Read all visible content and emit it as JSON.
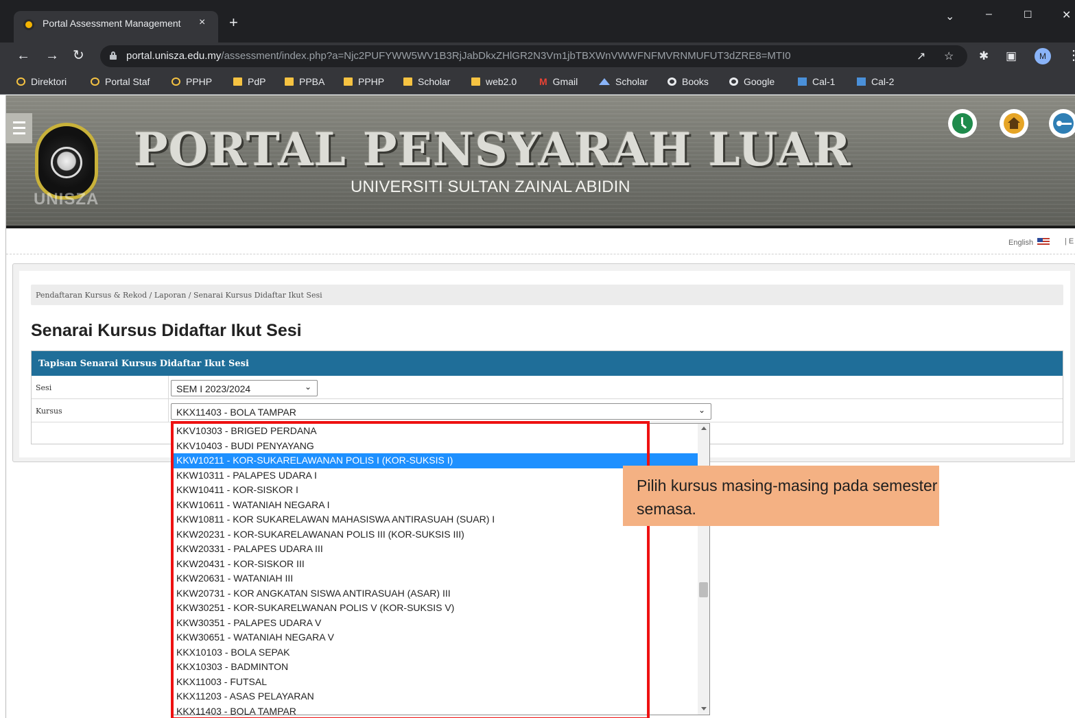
{
  "browser": {
    "tab_title": "Portal Assessment Management",
    "tab_close": "×",
    "new_tab": "+",
    "url_host": "portal.unisza.edu.my",
    "url_path": "/assessment/index.php?a=Njc2PUFYWW5WV1B3RjJabDkxZHlGR2N3Vm1jbTBXWnVWWFNFMVRNMUFUT3dZRE8=MTI0",
    "profile_initial": "M",
    "colors": {
      "frame": "#1f2023",
      "toolbar": "#35363a",
      "omnibox": "#202124"
    }
  },
  "bookmarks": [
    {
      "label": "Direktori",
      "icon": "globe-icon"
    },
    {
      "label": "Portal Staf",
      "icon": "globe-icon"
    },
    {
      "label": "PPHP",
      "icon": "globe-icon"
    },
    {
      "label": "PdP",
      "icon": "folder-icon"
    },
    {
      "label": "PPBA",
      "icon": "folder-icon"
    },
    {
      "label": "PPHP",
      "icon": "folder-icon"
    },
    {
      "label": "Scholar",
      "icon": "folder-icon"
    },
    {
      "label": "web2.0",
      "icon": "folder-icon"
    },
    {
      "label": "Gmail",
      "icon": "gmail-icon"
    },
    {
      "label": "Scholar",
      "icon": "scholar-cap-icon"
    },
    {
      "label": "Books",
      "icon": "google-icon"
    },
    {
      "label": "Google",
      "icon": "google-icon"
    },
    {
      "label": "Cal-1",
      "icon": "calendar-icon"
    },
    {
      "label": "Cal-2",
      "icon": "calendar-icon"
    }
  ],
  "header": {
    "logo_text": "UNISZA",
    "title": "PORTAL PENSYARAH LUAR",
    "subtitle": "UNIVERSITI SULTAN ZAINAL ABIDIN",
    "language": "English",
    "language_separator": "| E",
    "icons": [
      "clock-icon",
      "home-icon",
      "key-icon"
    ]
  },
  "breadcrumb": "Pendaftaran Kursus & Rekod / Laporan / Senarai Kursus Didaftar Ikut Sesi",
  "page_title": "Senarai Kursus Didaftar Ikut Sesi",
  "filter": {
    "heading": "Tapisan Senarai Kursus Didaftar Ikut Sesi",
    "sesi_label": "Sesi",
    "sesi_value": "SEM I 2023/2024",
    "kursus_label": "Kursus",
    "kursus_value": "KKX11403 - BOLA TAMPAR",
    "chevron": "⌄"
  },
  "dropdown": {
    "selected_index": 2,
    "options": [
      "KKV10303 - BRIGED PERDANA",
      "KKV10403 - BUDI PENYAYANG",
      "KKW10211 - KOR-SUKARELAWANAN POLIS I (KOR-SUKSIS I)",
      "KKW10311 - PALAPES UDARA I",
      "KKW10411 - KOR-SISKOR I",
      "KKW10611 - WATANIAH NEGARA I",
      "KKW10811 - KOR SUKARELAWAN MAHASISWA ANTIRASUAH (SUAR) I",
      "KKW20231 - KOR-SUKARELAWANAN POLIS III (KOR-SUKSIS III)",
      "KKW20331 - PALAPES UDARA III",
      "KKW20431 - KOR-SISKOR III",
      "KKW20631 - WATANIAH III",
      "KKW20731 - KOR ANGKATAN SISWA ANTIRASUAH (ASAR) III",
      "KKW30251 - KOR-SUKARELWANAN POLIS V (KOR-SUKSIS V)",
      "KKW30351 - PALAPES UDARA V",
      "KKW30651 - WATANIAH NEGARA V",
      "KKX10103 - BOLA SEPAK",
      "KKX10303 - BADMINTON",
      "KKX11003 - FUTSAL",
      "KKX11203 - ASAS PELAYARAN",
      "KKX11403 - BOLA TAMPAR"
    ]
  },
  "annotation": {
    "callout_text": "Pilih kursus masing-masing pada semester semasa.",
    "highlight_color": "#ee1111",
    "callout_color": "#f4b183"
  }
}
